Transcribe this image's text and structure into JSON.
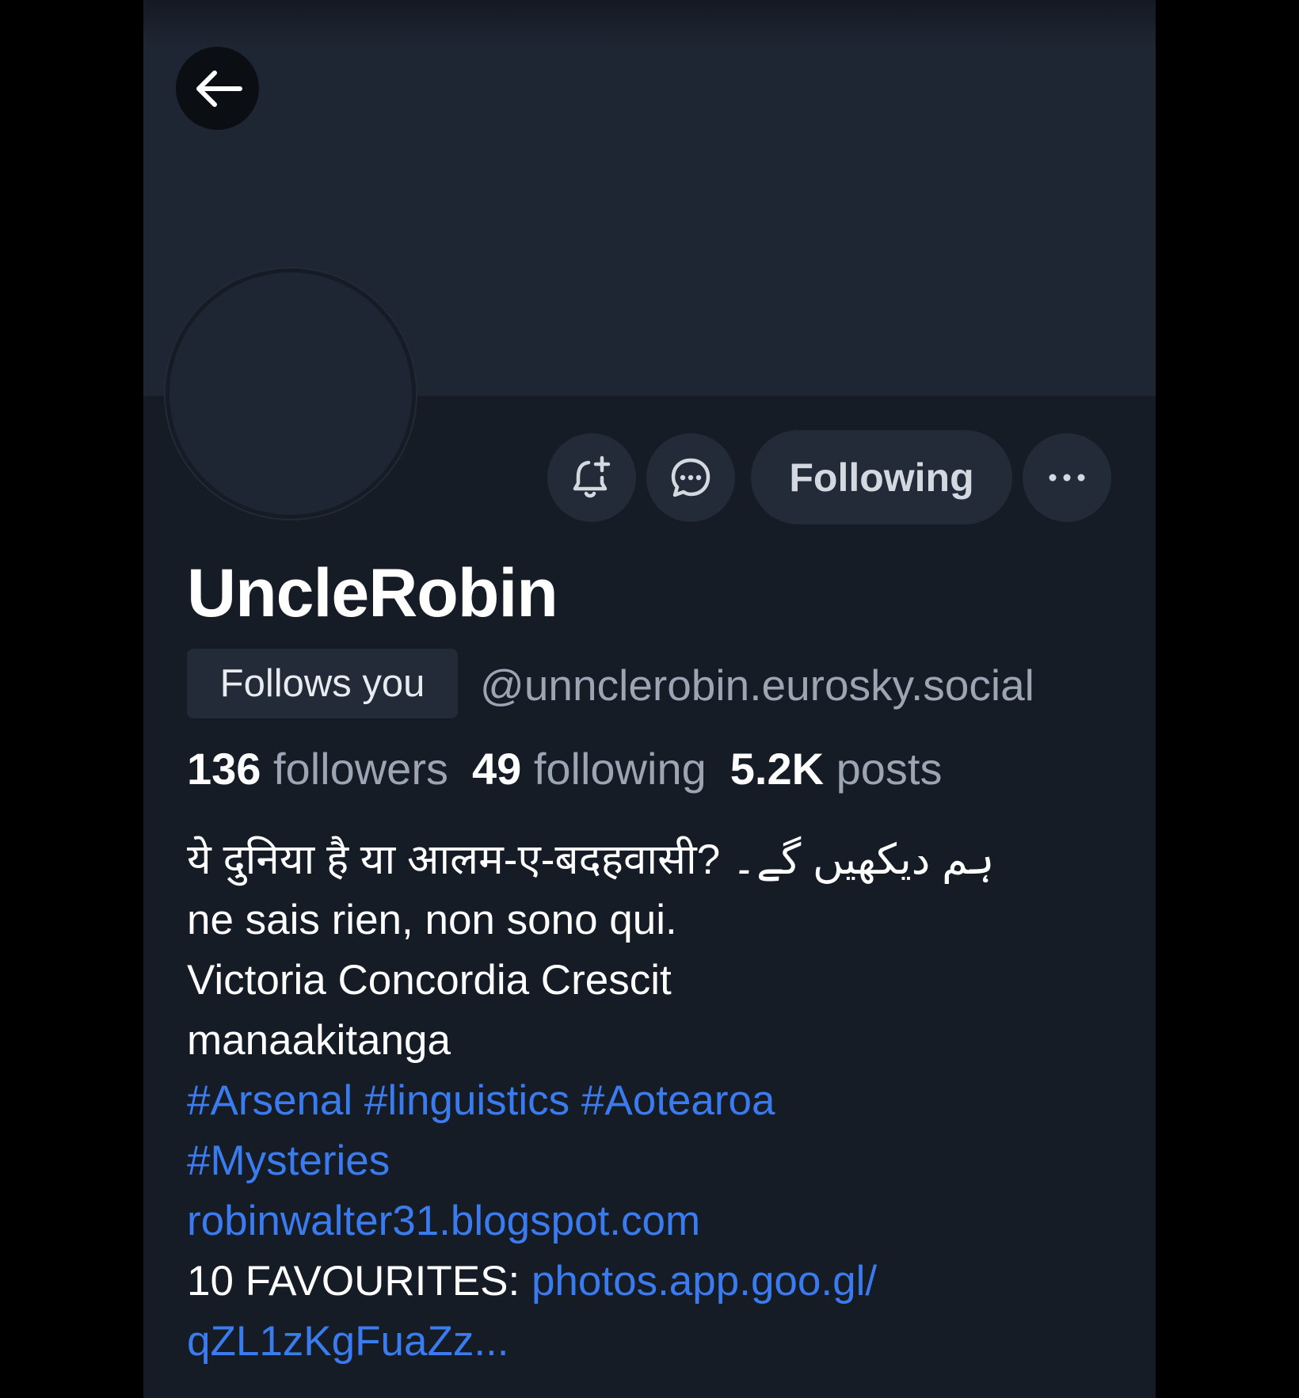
{
  "profile": {
    "display_name": "UncleRobin",
    "follows_you_label": "Follows you",
    "handle": "@unnclerobin.eurosky.social"
  },
  "actions": {
    "subscribe_icon": "bell-plus-icon",
    "message_icon": "chat-bubble-icon",
    "following_label": "Following",
    "more_icon": "ellipsis-icon",
    "back_icon": "arrow-left-icon"
  },
  "stats": {
    "followers_count": "136",
    "followers_label": "followers",
    "following_count": "49",
    "following_label": "following",
    "posts_count": "5.2K",
    "posts_label": "posts"
  },
  "bio": {
    "line1_hindi": "ये दुनिया है या आलम-ए-बदहवासी?",
    "line1_urdu": "ہم دیکھیں گے۔",
    "line2": "ne sais rien, non sono qui.",
    "line3": "Victoria Concordia Crescit",
    "line4": "manaakitanga",
    "hashtags_line1": [
      "#Arsenal",
      "#linguistics",
      "#Aotearoa"
    ],
    "hashtags_line2": [
      "#Mysteries"
    ],
    "blog_link": "robinwalter31.blogspot.com",
    "favourites_label": "10 FAVOURITES:",
    "favourites_link_part1": "photos.app.goo.gl/",
    "favourites_link_part2": "qZL1zKgFuaZz..."
  },
  "colors": {
    "background": "#161c26",
    "banner": "#1f2633",
    "button": "#232b38",
    "link": "#3b7bf0",
    "muted_text": "#9ca5b3"
  }
}
